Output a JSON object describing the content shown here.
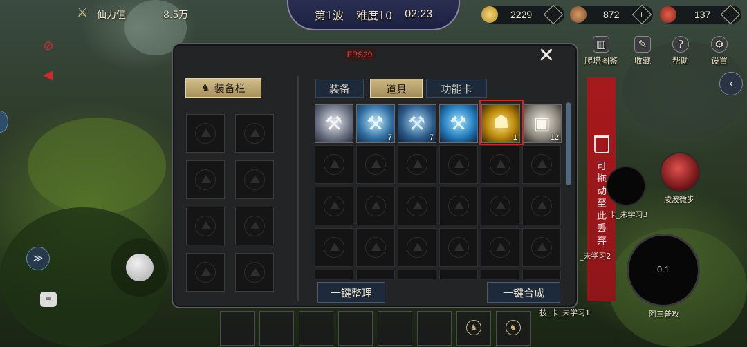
{
  "hud": {
    "power_label": "仙力值",
    "power_value": "8.5万",
    "wave": "第1波",
    "difficulty": "难度10",
    "timer": "02:23",
    "resources": [
      {
        "icon": "coin-icon",
        "value": "2229",
        "color": "#d6b64a"
      },
      {
        "icon": "wood-icon",
        "value": "872",
        "color": "#b07a4e"
      },
      {
        "icon": "flag-icon",
        "value": "137",
        "color": "#c8402e"
      }
    ],
    "top_menu": [
      {
        "icon": "tower-guide-icon",
        "label": "爬塔图鉴",
        "glyph": "▥"
      },
      {
        "icon": "favorite-icon",
        "label": "收藏",
        "glyph": "✎"
      },
      {
        "icon": "help-icon",
        "label": "帮助",
        "glyph": "?"
      },
      {
        "icon": "settings-icon",
        "label": "设置",
        "glyph": "⚙"
      }
    ]
  },
  "panel": {
    "fps": "FPS29",
    "close_glyph": "✕",
    "equip_tab_label": "装备栏",
    "tabs": [
      {
        "label": "装备",
        "active": false
      },
      {
        "label": "道具",
        "active": true
      },
      {
        "label": "功能卡",
        "active": false
      }
    ],
    "items": [
      {
        "name": "silver-axe-item",
        "color": "#9aa4b6",
        "count": ""
      },
      {
        "name": "ice-hammer-item",
        "color": "#5da8d8",
        "count": "7"
      },
      {
        "name": "blue-hammer-item",
        "color": "#4d88b8",
        "count": "7"
      },
      {
        "name": "frost-hammer-item",
        "color": "#3f9ed8",
        "count": ""
      },
      {
        "name": "golden-shrine-item",
        "color": "#c8921c",
        "count": "1"
      },
      {
        "name": "treasure-chest-item",
        "color": "#c7c0b0",
        "count": "12"
      }
    ],
    "sort_button": "一键整理",
    "merge_button": "一键合成"
  },
  "trash": {
    "lines": [
      "可",
      "拖",
      "动",
      "至",
      "此",
      "丢",
      "弃"
    ]
  },
  "right_hud": {
    "skill_name": "凌波微步",
    "slot_label_1": "卡_未学习3",
    "slot_label_2": "_未学习2",
    "slot_label_3": "技_卡_未学习1",
    "attack_value": "0.1",
    "attack_label": "阿三普攻"
  }
}
